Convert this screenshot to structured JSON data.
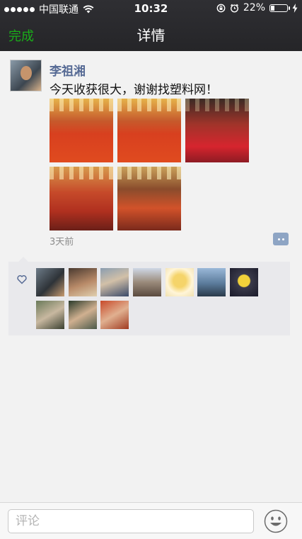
{
  "status_bar": {
    "carrier": "中国联通",
    "time": "10:32",
    "battery_percent": "22%",
    "battery_level": 0.22
  },
  "nav": {
    "back_label": "完成",
    "title": "详情"
  },
  "post": {
    "author": "李祖湘",
    "text": "今天收获很大，谢谢找塑料网！",
    "time": "3天前"
  },
  "comment_bar": {
    "placeholder": "评论"
  },
  "colors": {
    "accent_green": "#1aad19",
    "author_blue": "#576b95",
    "nav_bg": "#2a2a2d"
  }
}
